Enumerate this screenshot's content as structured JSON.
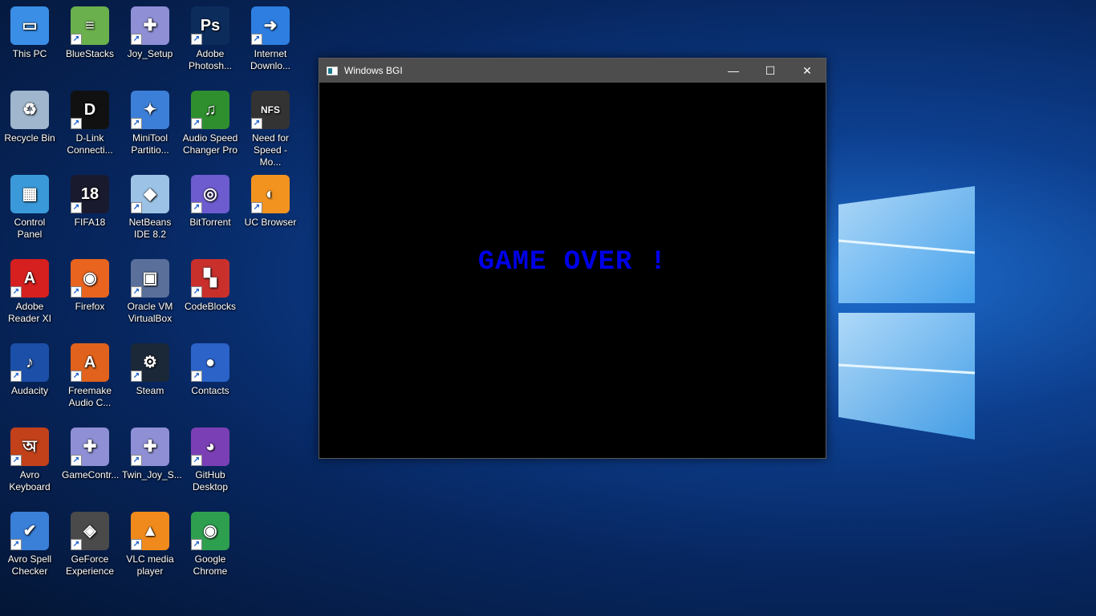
{
  "desktop": {
    "icons": [
      {
        "label": "This PC",
        "icon": "computer-icon",
        "color": "#3a8ee6",
        "glyph": "▭",
        "col": 0,
        "row": 0,
        "shortcut": false
      },
      {
        "label": "BlueStacks",
        "icon": "bluestacks-icon",
        "color": "#6ab04c",
        "glyph": "≡",
        "col": 1,
        "row": 0,
        "shortcut": true
      },
      {
        "label": "Joy_Setup",
        "icon": "gamepad-icon",
        "color": "#8f8fd6",
        "glyph": "✚",
        "col": 2,
        "row": 0,
        "shortcut": true
      },
      {
        "label": "Adobe Photosh...",
        "icon": "photoshop-icon",
        "color": "#0c2c5c",
        "glyph": "Ps",
        "col": 3,
        "row": 0,
        "shortcut": true
      },
      {
        "label": "Internet Downlo...",
        "icon": "idm-icon",
        "color": "#2d7ee0",
        "glyph": "➜",
        "col": 4,
        "row": 0,
        "shortcut": true
      },
      {
        "label": "Recycle Bin",
        "icon": "recycle-bin-icon",
        "color": "#9fb6cc",
        "glyph": "♻",
        "col": 0,
        "row": 1,
        "shortcut": false
      },
      {
        "label": "D-Link Connecti...",
        "icon": "dlink-icon",
        "color": "#111111",
        "glyph": "D",
        "col": 1,
        "row": 1,
        "shortcut": true
      },
      {
        "label": "MiniTool Partitio...",
        "icon": "minitool-icon",
        "color": "#3c7fd8",
        "glyph": "✦",
        "col": 2,
        "row": 1,
        "shortcut": true
      },
      {
        "label": "Audio Speed Changer Pro",
        "icon": "audio-speed-icon",
        "color": "#2f8f2f",
        "glyph": "♫",
        "col": 3,
        "row": 1,
        "shortcut": true
      },
      {
        "label": "Need for Speed - Mo...",
        "icon": "nfs-icon",
        "color": "#333333",
        "glyph": "NFS",
        "col": 4,
        "row": 1,
        "shortcut": true
      },
      {
        "label": "Control Panel",
        "icon": "control-panel-icon",
        "color": "#3a9ad9",
        "glyph": "▦",
        "col": 0,
        "row": 2,
        "shortcut": false
      },
      {
        "label": "FIFA18",
        "icon": "fifa-icon",
        "color": "#1a1a2e",
        "glyph": "18",
        "col": 1,
        "row": 2,
        "shortcut": true
      },
      {
        "label": "NetBeans IDE 8.2",
        "icon": "netbeans-icon",
        "color": "#9cc3e6",
        "glyph": "◆",
        "col": 2,
        "row": 2,
        "shortcut": true
      },
      {
        "label": "BitTorrent",
        "icon": "bittorrent-icon",
        "color": "#6d5bd0",
        "glyph": "◎",
        "col": 3,
        "row": 2,
        "shortcut": true
      },
      {
        "label": "UC Browser",
        "icon": "uc-browser-icon",
        "color": "#f29320",
        "glyph": "◐",
        "col": 4,
        "row": 2,
        "shortcut": true
      },
      {
        "label": "Adobe Reader XI",
        "icon": "adobe-reader-icon",
        "color": "#d61f1f",
        "glyph": "A",
        "col": 0,
        "row": 3,
        "shortcut": true
      },
      {
        "label": "Firefox",
        "icon": "firefox-icon",
        "color": "#e8641f",
        "glyph": "◉",
        "col": 1,
        "row": 3,
        "shortcut": true
      },
      {
        "label": "Oracle VM VirtualBox",
        "icon": "virtualbox-icon",
        "color": "#5a6f9a",
        "glyph": "▣",
        "col": 2,
        "row": 3,
        "shortcut": true
      },
      {
        "label": "CodeBlocks",
        "icon": "codeblocks-icon",
        "color": "#c9302c",
        "glyph": "▚",
        "col": 3,
        "row": 3,
        "shortcut": true
      },
      {
        "label": "Audacity",
        "icon": "audacity-icon",
        "color": "#1b4fa8",
        "glyph": "♪",
        "col": 0,
        "row": 4,
        "shortcut": true
      },
      {
        "label": "Freemake Audio C...",
        "icon": "freemake-icon",
        "color": "#e0621c",
        "glyph": "A",
        "col": 1,
        "row": 4,
        "shortcut": true
      },
      {
        "label": "Steam",
        "icon": "steam-icon",
        "color": "#1b2838",
        "glyph": "⚙",
        "col": 2,
        "row": 4,
        "shortcut": true
      },
      {
        "label": "Contacts",
        "icon": "contacts-icon",
        "color": "#2b63c9",
        "glyph": "●",
        "col": 3,
        "row": 4,
        "shortcut": true
      },
      {
        "label": "Avro Keyboard",
        "icon": "avro-keyboard-icon",
        "color": "#c2411b",
        "glyph": "অ",
        "col": 0,
        "row": 5,
        "shortcut": true
      },
      {
        "label": "GameContr...",
        "icon": "game-controller-icon",
        "color": "#8f8fd6",
        "glyph": "✚",
        "col": 1,
        "row": 5,
        "shortcut": true
      },
      {
        "label": "Twin_Joy_S...",
        "icon": "twin-joy-icon",
        "color": "#8f8fd6",
        "glyph": "✚",
        "col": 2,
        "row": 5,
        "shortcut": true
      },
      {
        "label": "GitHub Desktop",
        "icon": "github-icon",
        "color": "#7b3fb5",
        "glyph": "◕",
        "col": 3,
        "row": 5,
        "shortcut": true
      },
      {
        "label": "Avro Spell Checker",
        "icon": "avro-spell-icon",
        "color": "#3a7fd8",
        "glyph": "✔",
        "col": 0,
        "row": 6,
        "shortcut": true
      },
      {
        "label": "GeForce Experience",
        "icon": "geforce-icon",
        "color": "#4a4a4a",
        "glyph": "◈",
        "col": 1,
        "row": 6,
        "shortcut": true
      },
      {
        "label": "VLC media player",
        "icon": "vlc-icon",
        "color": "#f08a1c",
        "glyph": "▲",
        "col": 2,
        "row": 6,
        "shortcut": true
      },
      {
        "label": "Google Chrome",
        "icon": "chrome-icon",
        "color": "#2e9e4f",
        "glyph": "◉",
        "col": 3,
        "row": 6,
        "shortcut": true
      }
    ]
  },
  "window": {
    "title": "Windows BGI",
    "minimize_glyph": "—",
    "maximize_glyph": "☐",
    "close_glyph": "✕",
    "message": "GAME OVER !",
    "message_color": "#0000e6"
  }
}
